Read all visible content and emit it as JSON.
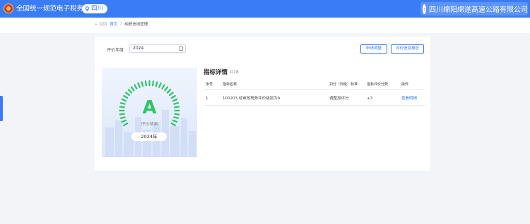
{
  "header": {
    "app_title": "全国统一规范电子税务局",
    "region": "四川",
    "company": "四川绵阳绵遂高速公路有限公司"
  },
  "breadcrumb": {
    "back": "← 返回",
    "home": "首页",
    "separator": "/",
    "current": "纳税信用管理"
  },
  "filter": {
    "year_label": "评价年度",
    "year_value": "2024"
  },
  "actions": {
    "apply_adjust": "申请调整",
    "report": "评价信息报告"
  },
  "result": {
    "grade": "A",
    "label": "评价结果",
    "year": "2024年",
    "grade_color": "#2ec46a"
  },
  "detail": {
    "title": "指标详情",
    "count": "共1条",
    "columns": [
      "序号",
      "指标名称",
      "扣分（判级）标准",
      "指标评价分数",
      "操作"
    ],
    "rows": [
      {
        "index": "1",
        "name": "100203.经审核税务评价级别为A",
        "standard": "调整加评分",
        "score": "+3",
        "action": "查看明细"
      }
    ]
  },
  "colors": {
    "accent": "#3a7cf5",
    "header_bg": "#3a7cf5"
  }
}
